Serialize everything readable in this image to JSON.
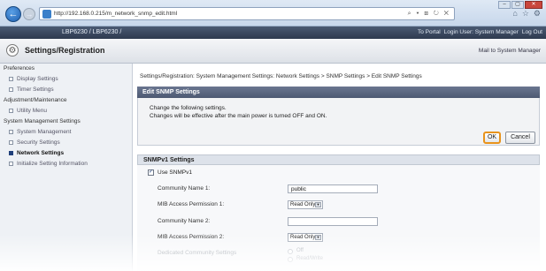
{
  "browser": {
    "url": "http://192.168.0.215/m_network_snmp_edit.html",
    "address_tools": "⌕ ▾ ⊠ ↻ ✕",
    "window_buttons": [
      "–",
      "▢",
      "✕"
    ],
    "toolbar_icons": [
      "home-icon",
      "star-icon",
      "gear-icon"
    ]
  },
  "device": {
    "name": "LBP6230 / LBP6230 /",
    "to_portal": "To Portal",
    "login_user": "Login User: System Manager",
    "log_out": "Log Out"
  },
  "header": {
    "title": "Settings/Registration",
    "mail_link": "Mail to System Manager"
  },
  "sidebar": {
    "items": [
      {
        "label": "Preferences",
        "type": "group"
      },
      {
        "label": "Display Settings",
        "type": "sub"
      },
      {
        "label": "Timer Settings",
        "type": "sub"
      },
      {
        "label": "Adjustment/Maintenance",
        "type": "group"
      },
      {
        "label": "Utility Menu",
        "type": "sub"
      },
      {
        "label": "System Management Settings",
        "type": "group"
      },
      {
        "label": "System Management",
        "type": "sub"
      },
      {
        "label": "Security Settings",
        "type": "sub"
      },
      {
        "label": "Network Settings",
        "type": "sub-active"
      },
      {
        "label": "Initialize Setting Information",
        "type": "sub"
      }
    ]
  },
  "main": {
    "breadcrumb": "Settings/Registration: System Management Settings: Network Settings > SNMP Settings > Edit SNMP Settings",
    "edit_title": "Edit SNMP Settings",
    "message_line1": "Change the following settings.",
    "message_line2": "Changes will be effective after the main power is turned OFF and ON.",
    "ok_label": "OK",
    "cancel_label": "Cancel",
    "section_title": "SNMPv1 Settings",
    "use_snmpv1_label": "Use SNMPv1",
    "use_snmpv1_checked": "✓",
    "community1_label": "Community Name 1:",
    "community1_value": "public",
    "mib1_label": "MIB Access Permission 1:",
    "mib1_value": "Read Only",
    "community2_label": "Community Name 2:",
    "community2_value": "",
    "mib2_label": "MIB Access Permission 2:",
    "mib2_value": "Read Only",
    "dedicated_label": "Dedicated Community Settings",
    "dedicated_opt1": "Off",
    "dedicated_opt2": "Read/Write"
  }
}
